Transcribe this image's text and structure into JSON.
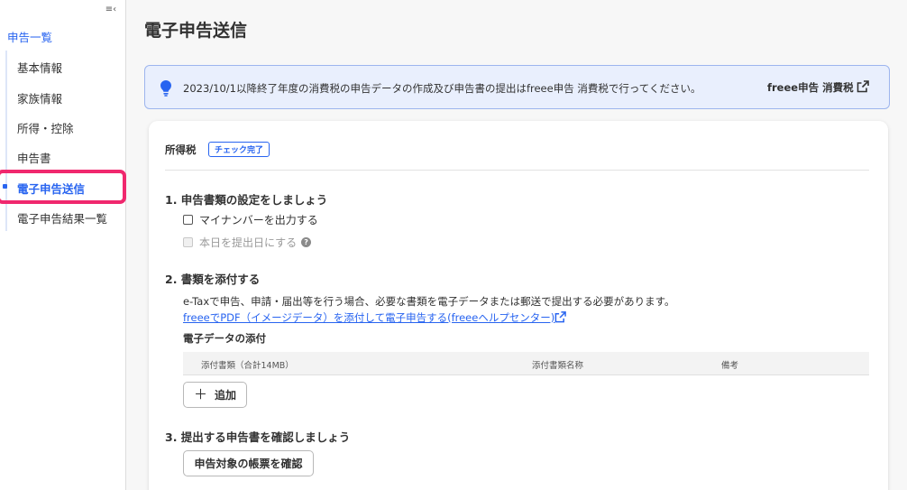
{
  "sidebar": {
    "collapse_icon": "≡‹",
    "title": "申告一覧",
    "items": [
      {
        "label": "基本情報"
      },
      {
        "label": "家族情報"
      },
      {
        "label": "所得・控除"
      },
      {
        "label": "申告書"
      },
      {
        "label": "電子申告送信",
        "active": true
      },
      {
        "label": "電子申告結果一覧"
      }
    ],
    "highlight_color": "#f0286e"
  },
  "page": {
    "title": "電子申告送信"
  },
  "notice": {
    "icon": "lightbulb-icon",
    "message": "2023/10/1以降終了年度の消費税の申告データの作成及び申告書の提出はfreee申告 消費税で行ってください。",
    "link_label": "freee申告 消費税",
    "link_icon": "external-link-icon"
  },
  "card": {
    "tax_label": "所得税",
    "status_badge": "チェック完了",
    "section1": {
      "title": "1. 申告書類の設定をしましょう",
      "options": [
        {
          "label": "マイナンバーを出力する",
          "checked": false,
          "disabled": false
        },
        {
          "label": "本日を提出日にする",
          "checked": false,
          "disabled": true
        }
      ]
    },
    "section2": {
      "title": "2. 書類を添付する",
      "description": "e-Taxで申告、申請・届出等を行う場合、必要な書類を電子データまたは郵送で提出する必要があります。",
      "help_link": "freeeでPDF（イメージデータ）を添付して電子申告する(freeeヘルプセンター)",
      "attachments_title": "電子データの添付",
      "table_headers": [
        "添付書類（合計14MB）",
        "添付書類名称",
        "備考"
      ],
      "add_button": "追加"
    },
    "section3": {
      "title": "3. 提出する申告書を確認しましょう",
      "confirm_button": "申告対象の帳票を確認"
    }
  },
  "colors": {
    "accent": "#2864f0",
    "notice_bg": "#e9effd",
    "notice_border": "#9db5ee"
  }
}
